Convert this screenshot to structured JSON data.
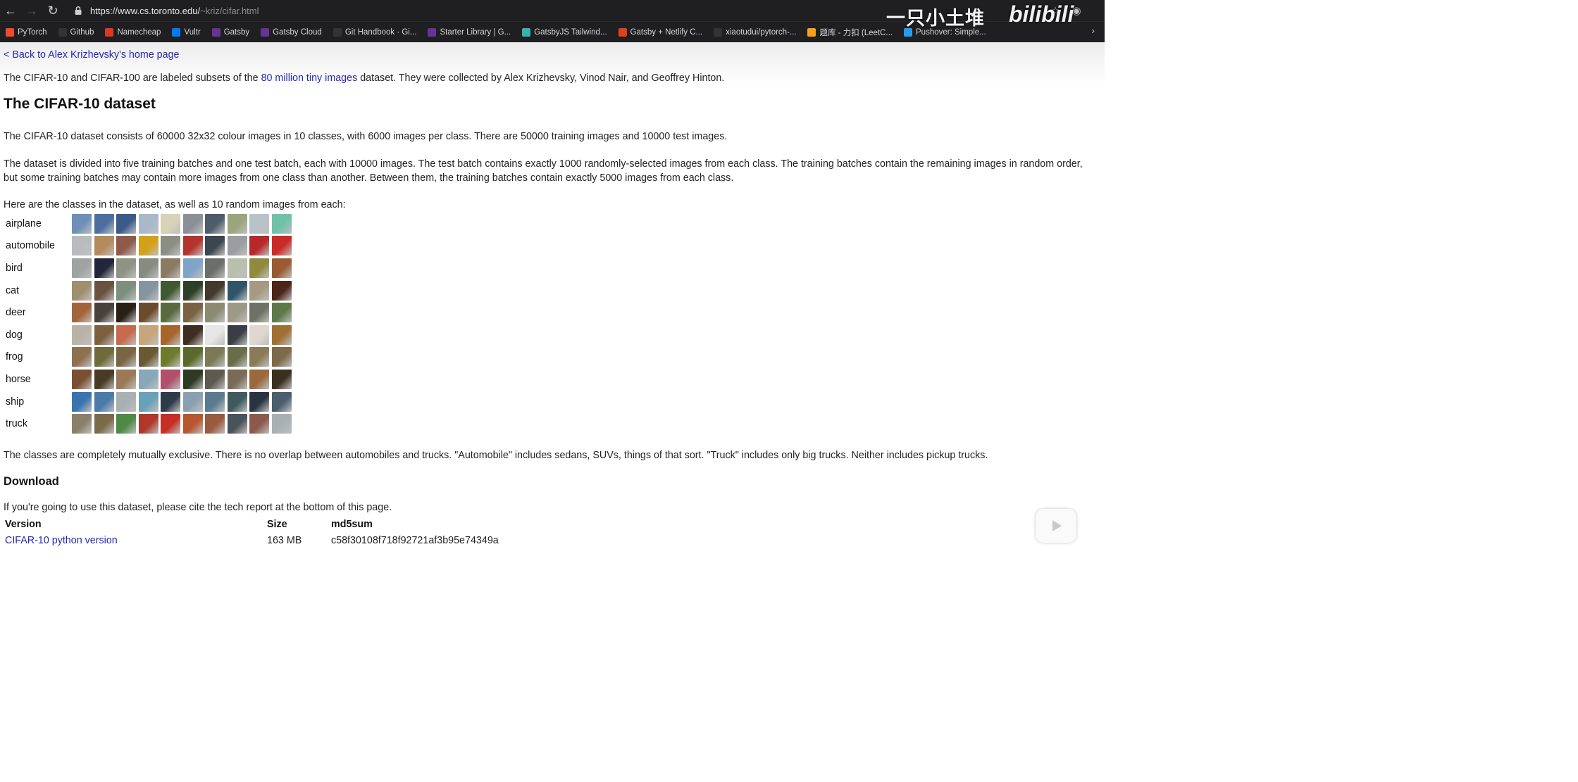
{
  "browser": {
    "url_host": "https://www.cs.toronto.edu/",
    "url_path": "~kriz/cifar.html",
    "bookmarks": [
      {
        "label": "PyTorch",
        "color": "#ee4c2c",
        "icon": "pytorch-icon"
      },
      {
        "label": "Github",
        "color": "#333333",
        "icon": "github-icon"
      },
      {
        "label": "Namecheap",
        "color": "#de3723",
        "icon": "namecheap-icon"
      },
      {
        "label": "Vultr",
        "color": "#007bfc",
        "icon": "vultr-icon"
      },
      {
        "label": "Gatsby",
        "color": "#663399",
        "icon": "gatsby-icon"
      },
      {
        "label": "Gatsby Cloud",
        "color": "#663399",
        "icon": "gatsby-icon"
      },
      {
        "label": "Git Handbook · Gi...",
        "color": "#333333",
        "icon": "github-icon"
      },
      {
        "label": "Starter Library | G...",
        "color": "#663399",
        "icon": "gatsby-icon"
      },
      {
        "label": "GatsbyJS Tailwind...",
        "color": "#38b2ac",
        "icon": "tailwind-icon"
      },
      {
        "label": "Gatsby + Netlify C...",
        "color": "#e2411d",
        "icon": "netlify-icon"
      },
      {
        "label": "xiaotudui/pytorch-...",
        "color": "#333333",
        "icon": "github-icon"
      },
      {
        "label": "题库 - 力扣 (LeetC...",
        "color": "#f89f1b",
        "icon": "leetcode-icon"
      },
      {
        "label": "Pushover: Simple...",
        "color": "#249df1",
        "icon": "pushover-icon"
      }
    ],
    "watermark_cn": "一只小土堆",
    "watermark_brand": "bilibili"
  },
  "page": {
    "back_link": "< Back to Alex Krizhevsky's home page",
    "intro_before": "The CIFAR-10 and CIFAR-100 are labeled subsets of the ",
    "intro_link": "80 million tiny images",
    "intro_after": " dataset. They were collected by Alex Krizhevsky, Vinod Nair, and Geoffrey Hinton.",
    "title": "The CIFAR-10 dataset",
    "p1": "The CIFAR-10 dataset consists of 60000 32x32 colour images in 10 classes, with 6000 images per class. There are 50000 training images and 10000 test images.",
    "p2": "The dataset is divided into five training batches and one test batch, each with 10000 images. The test batch contains exactly 1000 randomly-selected images from each class. The training batches contain the remaining images in random order, but some training batches may contain more images from one class than another. Between them, the training batches contain exactly 5000 images from each class.",
    "p3": "Here are the classes in the dataset, as well as 10 random images from each:",
    "classes": [
      {
        "label": "airplane",
        "colors": [
          "#6d8fb8",
          "#4b6f9e",
          "#3a5a8a",
          "#a9b9c9",
          "#d8d2b8",
          "#8a9096",
          "#4d5c6a",
          "#9aa57c",
          "#b8c2c8",
          "#6fc2a8"
        ]
      },
      {
        "label": "automobile",
        "colors": [
          "#b9bcbd",
          "#b38a5b",
          "#8f5a4a",
          "#d4a017",
          "#8a8f84",
          "#b5332c",
          "#3a4650",
          "#9a9ea2",
          "#b8272b",
          "#cc2a26"
        ]
      },
      {
        "label": "bird",
        "colors": [
          "#9ea3a2",
          "#22263a",
          "#8d9484",
          "#878c82",
          "#8a7a60",
          "#7fa4c8",
          "#6c6e6a",
          "#b8c0ad",
          "#8f8a3e",
          "#9a5a32"
        ]
      },
      {
        "label": "cat",
        "colors": [
          "#a08e6e",
          "#6b5140",
          "#7d9080",
          "#8694a0",
          "#3f5a30",
          "#2e3f27",
          "#43392c",
          "#2f5568",
          "#a79a82",
          "#4c2418"
        ]
      },
      {
        "label": "deer",
        "colors": [
          "#a4643a",
          "#49403a",
          "#2a2016",
          "#6b4a2d",
          "#5a6a3e",
          "#7a6240",
          "#8c8a70",
          "#9c9a86",
          "#6e7266",
          "#5e7a48"
        ]
      },
      {
        "label": "dog",
        "colors": [
          "#b9b2a8",
          "#7e5f3e",
          "#c56a4c",
          "#c7a47a",
          "#a8642c",
          "#3e2e22",
          "#e6e6e6",
          "#3a3e44",
          "#ded8d0",
          "#a07032"
        ]
      },
      {
        "label": "frog",
        "colors": [
          "#8e6f50",
          "#6e6a3c",
          "#7a6644",
          "#6a5a34",
          "#6e7a2e",
          "#5a6a2a",
          "#7b7a56",
          "#6a6e48",
          "#8a7a58",
          "#7e6a48"
        ]
      },
      {
        "label": "horse",
        "colors": [
          "#7a4e30",
          "#4a3a24",
          "#9a7a56",
          "#86a8b8",
          "#b0506a",
          "#2e3a22",
          "#5e5a50",
          "#7a6a56",
          "#9a6a3e",
          "#3a3020"
        ]
      },
      {
        "label": "ship",
        "colors": [
          "#3a74b0",
          "#4a7aa8",
          "#a8b0b4",
          "#6aa0b8",
          "#2e3a48",
          "#8aa0b0",
          "#5a7a90",
          "#3e5a5e",
          "#2a3440",
          "#4a5e6e"
        ]
      },
      {
        "label": "truck",
        "colors": [
          "#8a8068",
          "#7a6a4a",
          "#4e8a46",
          "#b0382a",
          "#c62e26",
          "#b8562e",
          "#9a5a40",
          "#4a525a",
          "#8c5a4c",
          "#a8b0b4"
        ]
      }
    ],
    "p4": "The classes are completely mutually exclusive. There is no overlap between automobiles and trucks. \"Automobile\" includes sedans, SUVs, things of that sort. \"Truck\" includes only big trucks. Neither includes pickup trucks.",
    "download_heading": "Download",
    "p5": "If you're going to use this dataset, please cite the tech report at the bottom of this page.",
    "table": {
      "headers": [
        "Version",
        "Size",
        "md5sum"
      ],
      "rows": [
        {
          "version": "CIFAR-10 python version",
          "size": "163 MB",
          "md5": "c58f30108f718f92721af3b95e74349a"
        }
      ]
    }
  }
}
